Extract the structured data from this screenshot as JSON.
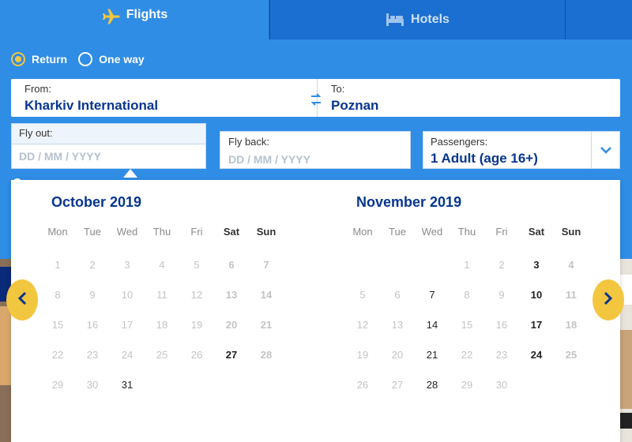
{
  "tabs": {
    "flights_label": "Flights",
    "hotels_label": "Hotels"
  },
  "trip_type": {
    "return_label": "Return",
    "one_way_label": "One way",
    "selected": "Return"
  },
  "route": {
    "from_label": "From:",
    "from_value": "Kharkiv International",
    "to_label": "To:",
    "to_value": "Poznan"
  },
  "dates": {
    "fly_out_label": "Fly out:",
    "fly_out_placeholder": "DD / MM / YYYY",
    "fly_back_label": "Fly back:",
    "fly_back_placeholder": "DD / MM / YYYY"
  },
  "passengers": {
    "label": "Passengers:",
    "value": "1 Adult (age 16+)"
  },
  "calendar": {
    "weekdays": [
      "Mon",
      "Tue",
      "Wed",
      "Thu",
      "Fri",
      "Sat",
      "Sun"
    ],
    "months": [
      {
        "title": "October 2019",
        "first_weekday": 1,
        "days": 31,
        "available": [
          27,
          31
        ]
      },
      {
        "title": "November 2019",
        "first_weekday": 4,
        "days": 30,
        "available": [
          3,
          7,
          10,
          14,
          17,
          21,
          24,
          28
        ]
      }
    ]
  },
  "colors": {
    "brand_blue": "#2f8de5",
    "dark_blue": "#073590",
    "accent_yellow": "#f3c63f"
  }
}
